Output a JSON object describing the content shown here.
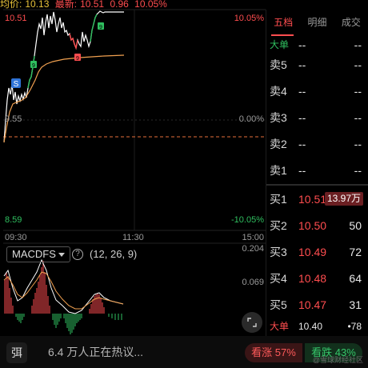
{
  "header": {
    "avg_label": "均价:",
    "avg_value": "10.13",
    "last_label": "最新:",
    "last_value": "10.51",
    "change_value": "0.96",
    "change_pct": "10.05%"
  },
  "chart": {
    "price_high": "10.51",
    "price_mid": "9.55",
    "price_low": "8.59",
    "pct_high": "10.05%",
    "pct_mid": "0.00%",
    "pct_low": "-10.05%",
    "time_start": "09:30",
    "time_mid": "11:30",
    "time_end": "15:00",
    "marker_s": "S",
    "marker_9a": "9",
    "marker_9b": "9",
    "marker_9c": "9",
    "colors": {
      "price_line": "#ffffff",
      "avg_line": "#f0a050",
      "limit_up_line": "#ff4d4f",
      "prev_close_line": "#e8703a",
      "green": "#2fbf5f",
      "red": "#ff4d4f"
    }
  },
  "macd": {
    "title": "MACDFS",
    "help_icon": "question-circle-icon",
    "params": "(12, 26, 9)",
    "axis_top": "0.204",
    "axis_mid": "0.069",
    "expand_icon": "expand-arrows-icon"
  },
  "book": {
    "tabs": [
      "五档",
      "明细",
      "成交"
    ],
    "big_sell": {
      "label": "大单",
      "price": "--",
      "value": "--"
    },
    "asks": [
      {
        "label": "卖5",
        "price": "--",
        "value": "--"
      },
      {
        "label": "卖4",
        "price": "--",
        "value": "--"
      },
      {
        "label": "卖3",
        "price": "--",
        "value": "--"
      },
      {
        "label": "卖2",
        "price": "--",
        "value": "--"
      },
      {
        "label": "卖1",
        "price": "--",
        "value": "--"
      }
    ],
    "bids": [
      {
        "label": "买1",
        "price": "10.51",
        "value": "13.97万"
      },
      {
        "label": "买2",
        "price": "10.50",
        "value": "50"
      },
      {
        "label": "买3",
        "price": "10.49",
        "value": "72"
      },
      {
        "label": "买4",
        "price": "10.48",
        "value": "64"
      },
      {
        "label": "买5",
        "price": "10.47",
        "value": "31"
      }
    ],
    "big_buy": {
      "label": "大单",
      "price": "10.40",
      "value": "•78"
    }
  },
  "bottom": {
    "logo_text": "弭",
    "hot_text": "6.4 万人正在热议...",
    "bull_text": "看涨 57%",
    "bear_text": "看跌 43%",
    "watermark": "@雪球财经社区"
  }
}
